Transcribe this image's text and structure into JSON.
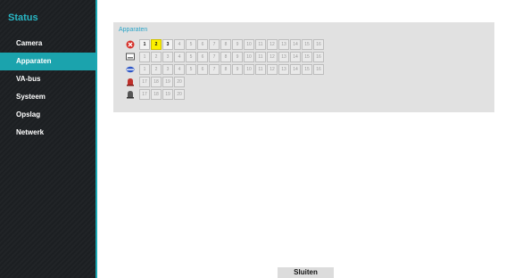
{
  "sidebar": {
    "title": "Status",
    "items": [
      {
        "label": "Camera",
        "active": false
      },
      {
        "label": "Apparaten",
        "active": true
      },
      {
        "label": "VA-bus",
        "active": false
      },
      {
        "label": "Systeem",
        "active": false
      },
      {
        "label": "Opslag",
        "active": false
      },
      {
        "label": "Netwerk",
        "active": false
      }
    ]
  },
  "panel": {
    "title": "Apparaten",
    "rows": [
      {
        "icon": "alarm-error-icon",
        "cells": [
          "1",
          "2",
          "3",
          "4",
          "5",
          "6",
          "7",
          "8",
          "9",
          "10",
          "11",
          "12",
          "13",
          "14",
          "15",
          "16"
        ],
        "active": [
          1,
          2,
          3
        ],
        "highlight": [
          2
        ]
      },
      {
        "icon": "monitor-icon",
        "cells": [
          "1",
          "2",
          "3",
          "4",
          "5",
          "6",
          "7",
          "8",
          "9",
          "10",
          "11",
          "12",
          "13",
          "14",
          "15",
          "16"
        ],
        "active": [],
        "highlight": []
      },
      {
        "icon": "ptz-camera-icon",
        "cells": [
          "1",
          "2",
          "3",
          "4",
          "5",
          "6",
          "7",
          "8",
          "9",
          "10",
          "11",
          "12",
          "13",
          "14",
          "15",
          "16"
        ],
        "active": [],
        "highlight": []
      },
      {
        "icon": "alarm-in-icon",
        "cells": [
          "17",
          "18",
          "19",
          "20"
        ],
        "active": [],
        "highlight": []
      },
      {
        "icon": "alarm-out-icon",
        "cells": [
          "17",
          "18",
          "19",
          "20"
        ],
        "active": [],
        "highlight": []
      }
    ]
  },
  "footer": {
    "close_label": "Sluiten"
  },
  "colors": {
    "accent": "#1ba3ad",
    "highlight": "#fbf000",
    "title_blue": "#29b6c4"
  }
}
